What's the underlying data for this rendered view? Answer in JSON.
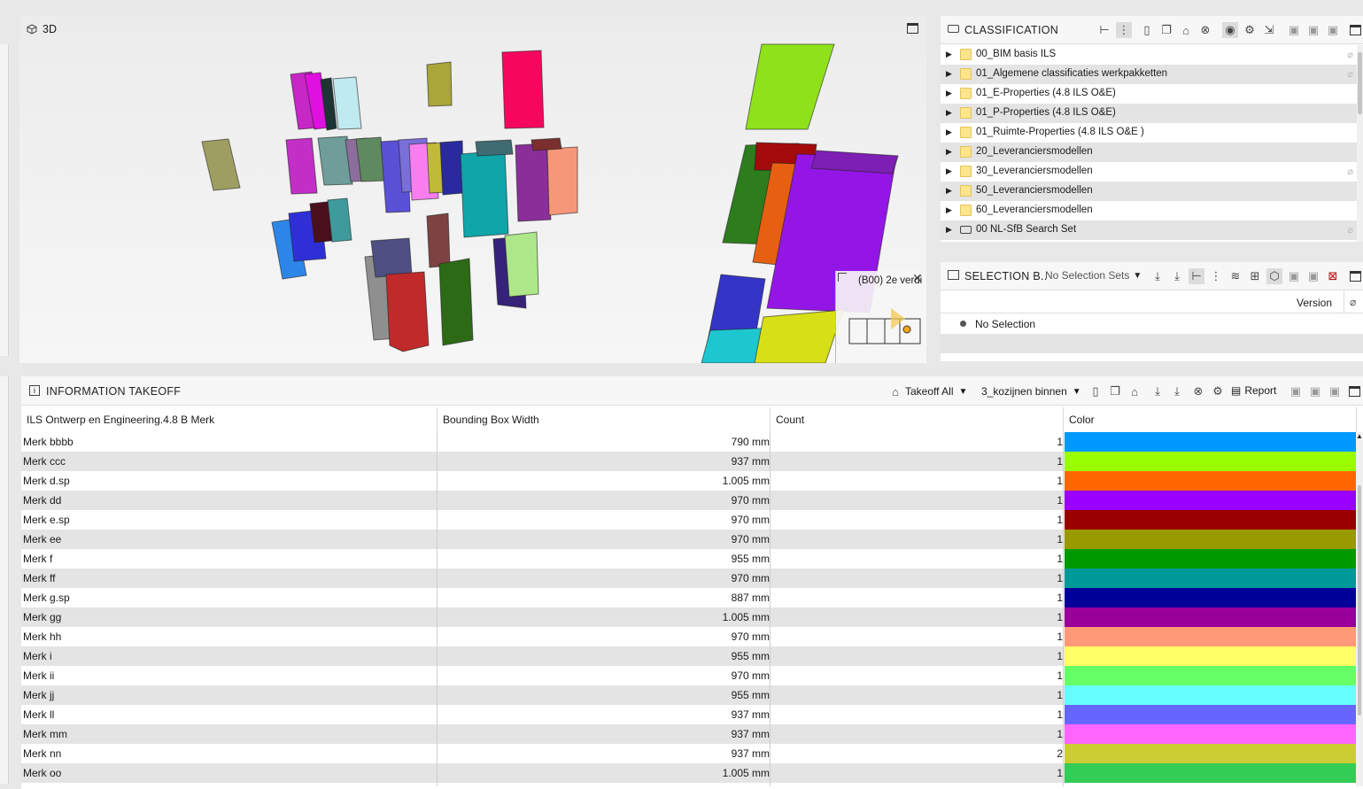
{
  "viewport": {
    "title": "3D",
    "location_popup": "(B00) 2e verdi"
  },
  "classification": {
    "title": "CLASSIFICATION",
    "items": [
      {
        "label": "00_BIM basis ILS",
        "type": "folder",
        "clip": true
      },
      {
        "label": "01_Algemene classificaties werkpakketten",
        "type": "folder",
        "clip": true
      },
      {
        "label": "01_E-Properties (4.8 ILS O&E)",
        "type": "folder",
        "clip": false
      },
      {
        "label": "01_P-Properties (4.8 ILS O&E)",
        "type": "folder",
        "clip": false
      },
      {
        "label": "01_Ruimte-Properties (4.8 ILS O&E )",
        "type": "folder",
        "clip": false
      },
      {
        "label": "20_Leveranciersmodellen",
        "type": "folder",
        "clip": false
      },
      {
        "label": "30_Leveranciersmodellen",
        "type": "folder",
        "clip": true
      },
      {
        "label": "50_Leveranciersmodellen",
        "type": "folder",
        "clip": false
      },
      {
        "label": "60_Leveranciersmodellen",
        "type": "folder",
        "clip": false
      },
      {
        "label": "00 NL-SfB Search Set",
        "type": "searchset",
        "clip": true
      }
    ]
  },
  "selection": {
    "title": "SELECTION B..",
    "dropdown": "No Selection Sets",
    "column_version": "Version",
    "empty_label": "No Selection"
  },
  "takeoff": {
    "title": "INFORMATION TAKEOFF",
    "mode_dropdown": "Takeoff All",
    "set_dropdown": "3_kozijnen binnen",
    "report_label": "Report",
    "columns": [
      "ILS Ontwerp en Engineering.4.8 B Merk",
      "Bounding Box Width",
      "Count",
      "Color"
    ],
    "rows": [
      {
        "merk": "Merk bbbb",
        "width": "790 mm",
        "count": "1",
        "color": "#0099ff"
      },
      {
        "merk": "Merk ccc",
        "width": "937 mm",
        "count": "1",
        "color": "#99ff00"
      },
      {
        "merk": "Merk d.sp",
        "width": "1.005 mm",
        "count": "1",
        "color": "#ff6600"
      },
      {
        "merk": "Merk dd",
        "width": "970 mm",
        "count": "1",
        "color": "#9900ff"
      },
      {
        "merk": "Merk e.sp",
        "width": "970 mm",
        "count": "1",
        "color": "#990000"
      },
      {
        "merk": "Merk ee",
        "width": "970 mm",
        "count": "1",
        "color": "#999900"
      },
      {
        "merk": "Merk f",
        "width": "955 mm",
        "count": "1",
        "color": "#009900"
      },
      {
        "merk": "Merk ff",
        "width": "970 mm",
        "count": "1",
        "color": "#009999"
      },
      {
        "merk": "Merk g.sp",
        "width": "887 mm",
        "count": "1",
        "color": "#000099"
      },
      {
        "merk": "Merk gg",
        "width": "1.005 mm",
        "count": "1",
        "color": "#990099"
      },
      {
        "merk": "Merk hh",
        "width": "970 mm",
        "count": "1",
        "color": "#ff9977"
      },
      {
        "merk": "Merk i",
        "width": "955 mm",
        "count": "1",
        "color": "#ffff66"
      },
      {
        "merk": "Merk ii",
        "width": "970 mm",
        "count": "1",
        "color": "#66ff66"
      },
      {
        "merk": "Merk jj",
        "width": "955 mm",
        "count": "1",
        "color": "#66ffff"
      },
      {
        "merk": "Merk ll",
        "width": "937 mm",
        "count": "1",
        "color": "#6666ff"
      },
      {
        "merk": "Merk mm",
        "width": "937 mm",
        "count": "1",
        "color": "#ff66ff"
      },
      {
        "merk": "Merk nn",
        "width": "937 mm",
        "count": "2",
        "color": "#cccc33"
      },
      {
        "merk": "Merk oo",
        "width": "1.005 mm",
        "count": "1",
        "color": "#33cc55"
      }
    ]
  }
}
